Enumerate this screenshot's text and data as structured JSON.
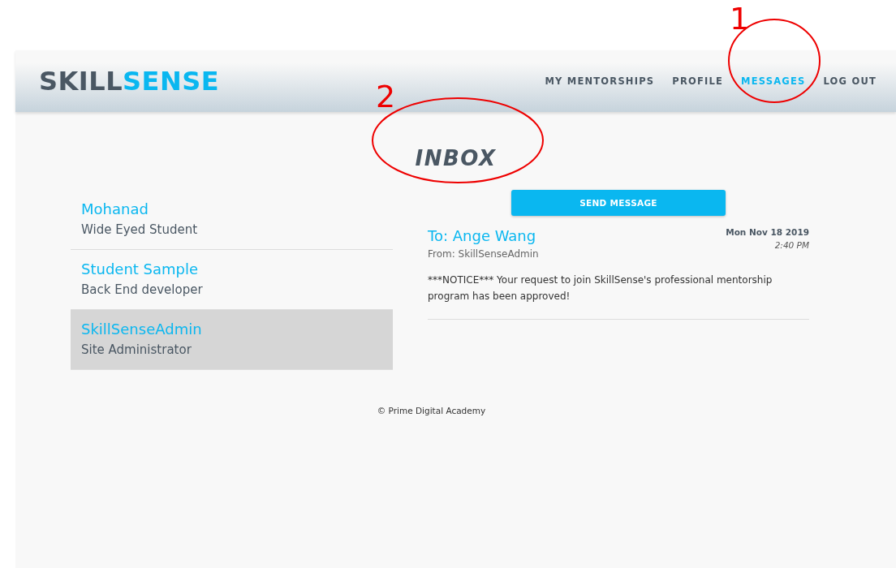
{
  "header": {
    "logo": {
      "part_1": "SKILL",
      "part_2": "SENSE"
    },
    "nav": [
      {
        "label": "MY MENTORSHIPS",
        "selected": false
      },
      {
        "label": "PROFILE",
        "selected": false
      },
      {
        "label": "MESSAGES",
        "selected": true
      },
      {
        "label": "LOG OUT",
        "selected": false
      }
    ]
  },
  "title": "INBOX",
  "contacts": [
    {
      "name": "Mohanad",
      "role": "Wide Eyed Student",
      "selected": false
    },
    {
      "name": "Student Sample",
      "role": "Back End developer",
      "selected": false
    },
    {
      "name": "SkillSenseAdmin",
      "role": "Site Administrator",
      "selected": true
    }
  ],
  "send_button": "SEND MESSAGE",
  "messages": [
    {
      "to": "To: Ange Wang",
      "from": "From: SkillSenseAdmin",
      "date": "Mon Nov 18 2019",
      "time": "2:40 PM",
      "body": "***NOTICE*** Your request to join SkillSense's professional mentorship program has been approved!"
    }
  ],
  "footer": "© Prime Digital Academy",
  "annotations": [
    {
      "number": "1"
    },
    {
      "number": "2"
    }
  ]
}
